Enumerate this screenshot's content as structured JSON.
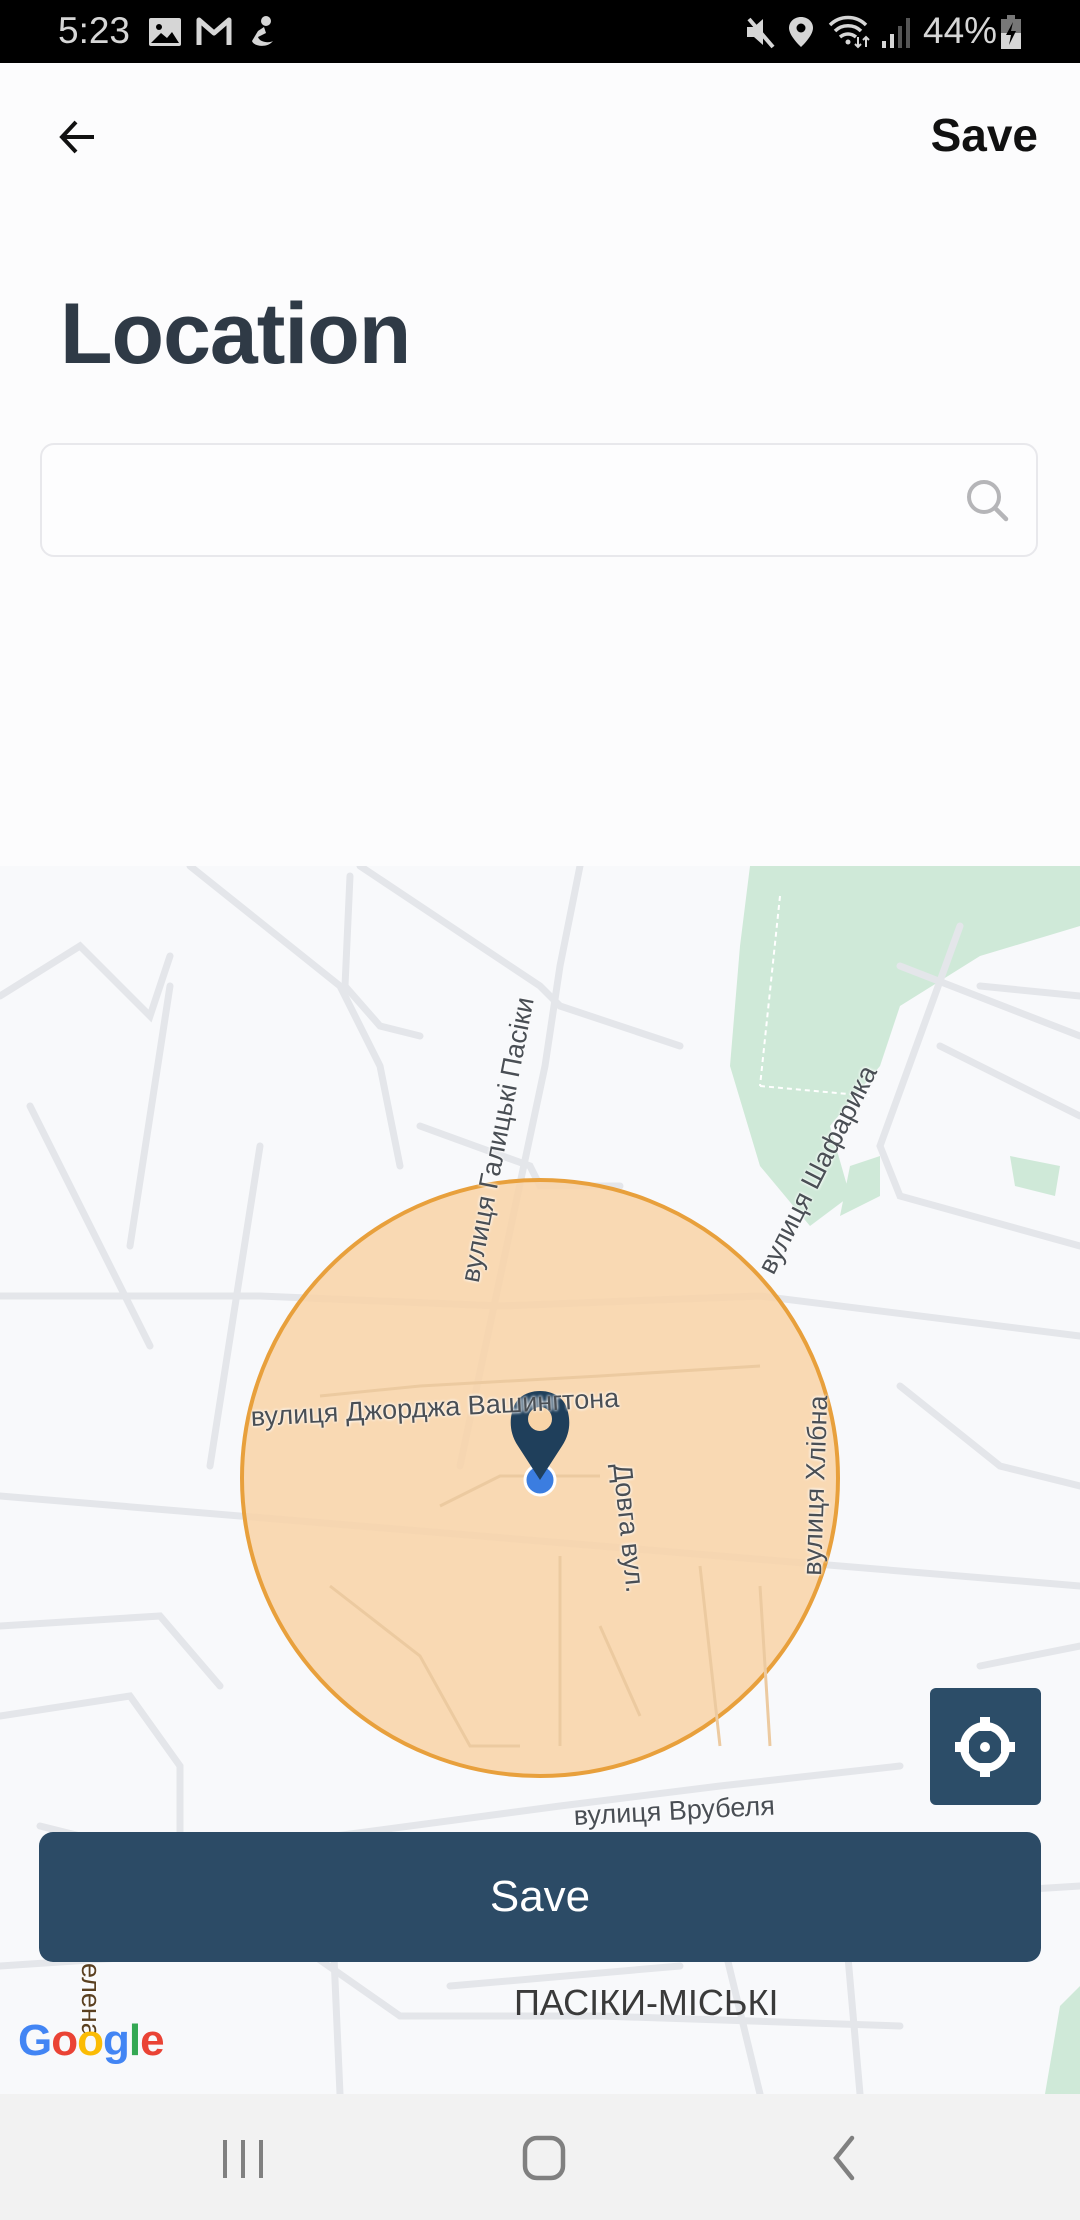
{
  "status_bar": {
    "time": "5:23",
    "left_icons": [
      "gallery-icon",
      "gmail-icon",
      "app-notification-icon"
    ],
    "right_icons": [
      "mute-icon",
      "location-icon",
      "wifi-icon",
      "signal-icon"
    ],
    "battery_percent": "44%",
    "battery_icon": "battery-charging-icon"
  },
  "app_bar": {
    "back_icon": "arrow-left-icon",
    "save_label": "Save"
  },
  "page": {
    "title": "Location"
  },
  "search": {
    "value": "",
    "placeholder": "",
    "icon": "search-icon"
  },
  "map": {
    "street_labels": {
      "galytski_pasiky": "вулиця Галицькі Пасіки",
      "shafaryka": "вулиця Шафарика",
      "washington": "вулиця Джорджа Вашингтона",
      "dovha": "Довга вул.",
      "khlibna": "вулиця Хлібна",
      "vrubelya": "вулиця Врубеля",
      "olena_partial": "елена"
    },
    "district_label": "ПАСІКИ-МІСЬКІ",
    "attribution": "Google",
    "radius_circle_fill": "#f8d4a8",
    "radius_circle_stroke": "#e8a03c",
    "pin_color": "#1f3f5b",
    "current_location_color": "#3b7de0",
    "park_color": "#cfe9d8",
    "locate_button_icon": "crosshair-icon"
  },
  "primary_action": {
    "save_label": "Save",
    "color": "#2c4b66"
  },
  "nav_bar": {
    "recents_icon": "recent-apps-icon",
    "home_icon": "home-icon",
    "back_icon": "back-chevron-icon"
  }
}
